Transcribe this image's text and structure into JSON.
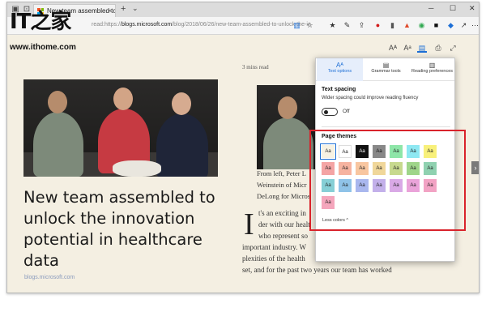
{
  "browser": {
    "tab_title": "New team assembled to",
    "tab_close": "×",
    "new_tab": "+",
    "tab_list": "⌄",
    "window_controls": [
      "─",
      "☐",
      "✕"
    ],
    "url_prefix": "read:https://",
    "url_host": "blogs.microsoft.com",
    "url_path": "/blog/2018/06/26/new-team-assembled-to-unlock-the-in"
  },
  "overlay": {
    "logo_glyph": "IT之家",
    "logo_url": "www.ithome.com"
  },
  "article": {
    "read_time": "3 mins read",
    "title": "New team assembled to unlock the innovation potential in healthcare data",
    "source": "blogs.microsoft.com",
    "caption_lines": [
      "From left, Peter L",
      "Weinstein of Micr",
      "DeLong for Micros"
    ],
    "dropcap": "I",
    "body_lines": [
      "t's an exciting in",
      "der with our healt",
      "who represent so",
      "important industry. W",
      "plexities of the health",
      "set, and for the past two years our team has worked"
    ]
  },
  "panel": {
    "tabs": [
      {
        "icon": "Aᴬ",
        "label": "Text options"
      },
      {
        "icon": "▤",
        "label": "Grammar tools"
      },
      {
        "icon": "▥",
        "label": "Reading preferences"
      }
    ],
    "text_spacing_heading": "Text spacing",
    "text_spacing_desc": "Wider spacing could improve reading fluency",
    "toggle_state": "Off",
    "page_themes_heading": "Page themes",
    "swatch_label": "Aa",
    "less_colors": "Less colors ^",
    "themes": [
      {
        "bg": "#f7f2e3",
        "fg": "#222222"
      },
      {
        "bg": "#ffffff",
        "fg": "#222222"
      },
      {
        "bg": "#111111",
        "fg": "#ffffff"
      },
      {
        "bg": "#888888",
        "fg": "#111111"
      },
      {
        "bg": "#8ee6a8",
        "fg": "#222222"
      },
      {
        "bg": "#8ee8f2",
        "fg": "#222222"
      },
      {
        "bg": "#f8f07a",
        "fg": "#222222"
      },
      {
        "bg": "#f4a4a4",
        "fg": "#222222"
      },
      {
        "bg": "#f6b3a0",
        "fg": "#222222"
      },
      {
        "bg": "#f8c6a0",
        "fg": "#222222"
      },
      {
        "bg": "#f0d79a",
        "fg": "#222222"
      },
      {
        "bg": "#c7d98e",
        "fg": "#222222"
      },
      {
        "bg": "#9fd58a",
        "fg": "#222222"
      },
      {
        "bg": "#8fd1b0",
        "fg": "#222222"
      },
      {
        "bg": "#86cfd6",
        "fg": "#222222"
      },
      {
        "bg": "#8fc3e8",
        "fg": "#222222"
      },
      {
        "bg": "#a9b7ee",
        "fg": "#222222"
      },
      {
        "bg": "#c3b0ea",
        "fg": "#222222"
      },
      {
        "bg": "#d9a9e6",
        "fg": "#222222"
      },
      {
        "bg": "#eaa3d9",
        "fg": "#222222"
      },
      {
        "bg": "#f2a3c4",
        "fg": "#222222"
      },
      {
        "bg": "#f4a6bc",
        "fg": "#222222"
      }
    ]
  },
  "colors": {
    "accent": "#1d6fd6",
    "highlight": "#d9232b",
    "reader_bg": "#f4efe2"
  }
}
